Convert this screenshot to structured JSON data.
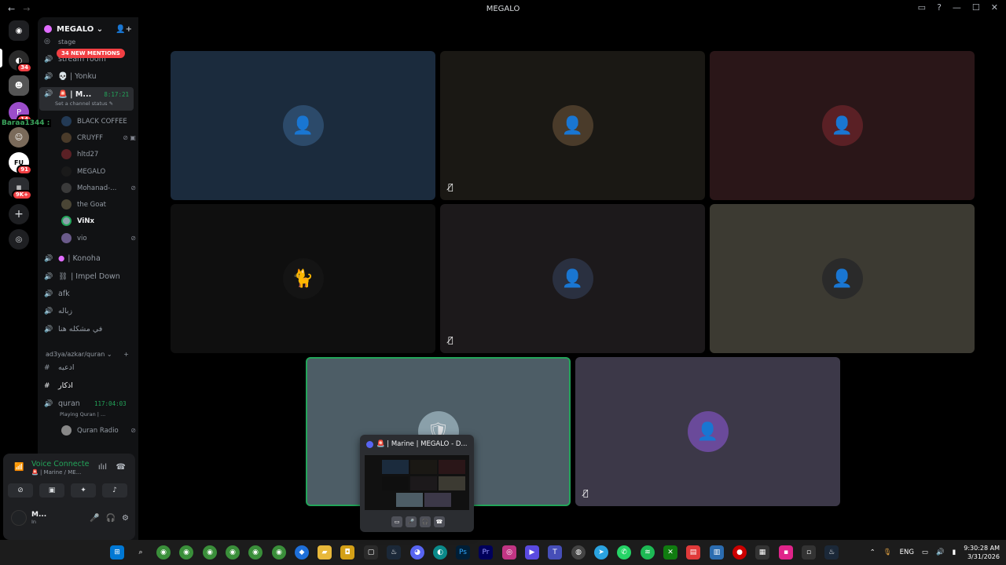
{
  "window": {
    "title": "MEGALO",
    "back": "←",
    "forward": "→"
  },
  "server": {
    "name": "MEGALO ⌄",
    "new_mentions": "34 NEW MENTIONS"
  },
  "guild_badges": {
    "g1": "34",
    "g2": "14",
    "g3": "91",
    "g4": "9K+"
  },
  "floating_user": "Baraa1344 :",
  "channels": {
    "stage_partial": "stage",
    "stream_room": "stream room",
    "yonku": "💀 | Yonku",
    "active": {
      "name": "🚨 | M...",
      "timer": "8:17:21",
      "status": "Set a channel status ✎"
    },
    "members": [
      {
        "name": "BLACK COFFEE",
        "icon": ""
      },
      {
        "name": "CRUYFF",
        "icon": "⊘ ▣"
      },
      {
        "name": "hltd27",
        "icon": ""
      },
      {
        "name": "MEGALO",
        "icon": ""
      },
      {
        "name": "Mohanad-...",
        "icon": "⊘"
      },
      {
        "name": "the Goat",
        "icon": ""
      },
      {
        "name": "ViNx",
        "icon": ""
      },
      {
        "name": "vio",
        "icon": "⊘"
      }
    ],
    "konoha": "| Konoha",
    "impel": "| Impel Down",
    "afk": "afk",
    "zbala": "زباله",
    "problem": "في مشكله هنا",
    "category": "ad3ya/azkar/quran ⌄",
    "ad3ya": "ادعيه",
    "azkar": "اذكار",
    "quran": {
      "name": "quran",
      "timer": "117:04:03",
      "status": "Playing Quran | ..."
    },
    "quran_radio": "Quran Radio"
  },
  "voice": {
    "connected": "Voice Connecte",
    "location": "🚨 | Marine / ME...",
    "user": "M...",
    "user_status": "In"
  },
  "preview": {
    "title": "🚨 | Marine | MEGALO - D..."
  },
  "tray": {
    "lang": "ENG",
    "time": "9:30:28 AM",
    "date": "3/31/2026"
  },
  "colors": {
    "speaking": "#23a55a",
    "badge": "#f23f43",
    "accent": "#5865f2"
  },
  "tiles": [
    {
      "bg": "#1b2b3d",
      "muted": false
    },
    {
      "bg": "#1a1814",
      "muted": true
    },
    {
      "bg": "#2a1618",
      "muted": false
    },
    {
      "bg": "#0f0f0f",
      "muted": false
    },
    {
      "bg": "#1c191b",
      "muted": true
    },
    {
      "bg": "#3c3a32",
      "muted": false
    },
    {
      "bg": "#4d5d66",
      "muted": false,
      "speaking": true
    },
    {
      "bg": "#3c3848",
      "muted": true
    }
  ]
}
